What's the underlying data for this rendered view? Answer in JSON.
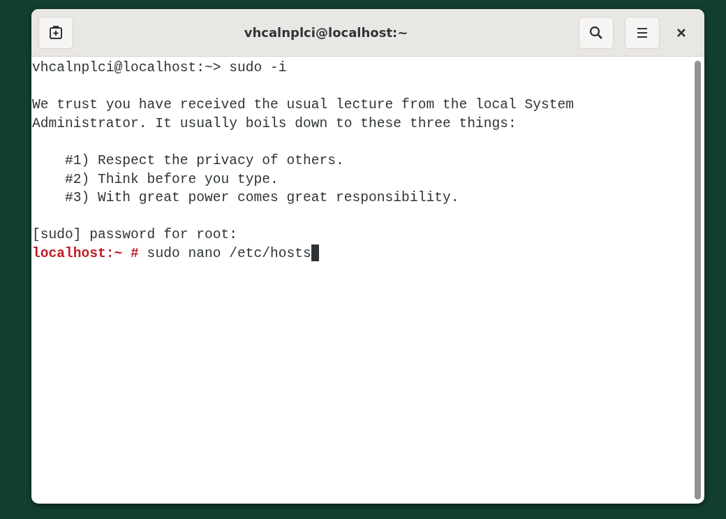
{
  "window": {
    "title": "vhcalnplci@localhost:~"
  },
  "terminal": {
    "lines": [
      {
        "kind": "output",
        "text": "vhcalnplci@localhost:~> sudo -i"
      },
      {
        "kind": "blank"
      },
      {
        "kind": "output",
        "text": "We trust you have received the usual lecture from the local System"
      },
      {
        "kind": "output",
        "text": "Administrator. It usually boils down to these three things:"
      },
      {
        "kind": "blank"
      },
      {
        "kind": "output",
        "text": "    #1) Respect the privacy of others."
      },
      {
        "kind": "output",
        "text": "    #2) Think before you type."
      },
      {
        "kind": "output",
        "text": "    #3) With great power comes great responsibility."
      },
      {
        "kind": "blank"
      },
      {
        "kind": "output",
        "text": "[sudo] password for root:"
      },
      {
        "kind": "prompt",
        "prompt": "localhost:~ #",
        "command": "sudo nano /etc/hosts"
      }
    ]
  }
}
